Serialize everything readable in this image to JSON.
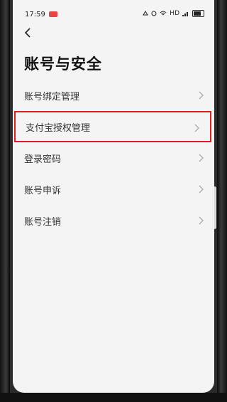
{
  "status_bar": {
    "time": "17:59",
    "right_text": "HD"
  },
  "header": {
    "title": "账号与安全"
  },
  "menu": {
    "items": [
      {
        "label": "账号绑定管理"
      },
      {
        "label": "支付宝授权管理",
        "highlighted": true
      },
      {
        "label": "登录密码"
      },
      {
        "label": "账号申诉"
      },
      {
        "label": "账号注销"
      }
    ]
  },
  "colors": {
    "highlight": "#e21d1d",
    "background": "#f4f4f4"
  }
}
